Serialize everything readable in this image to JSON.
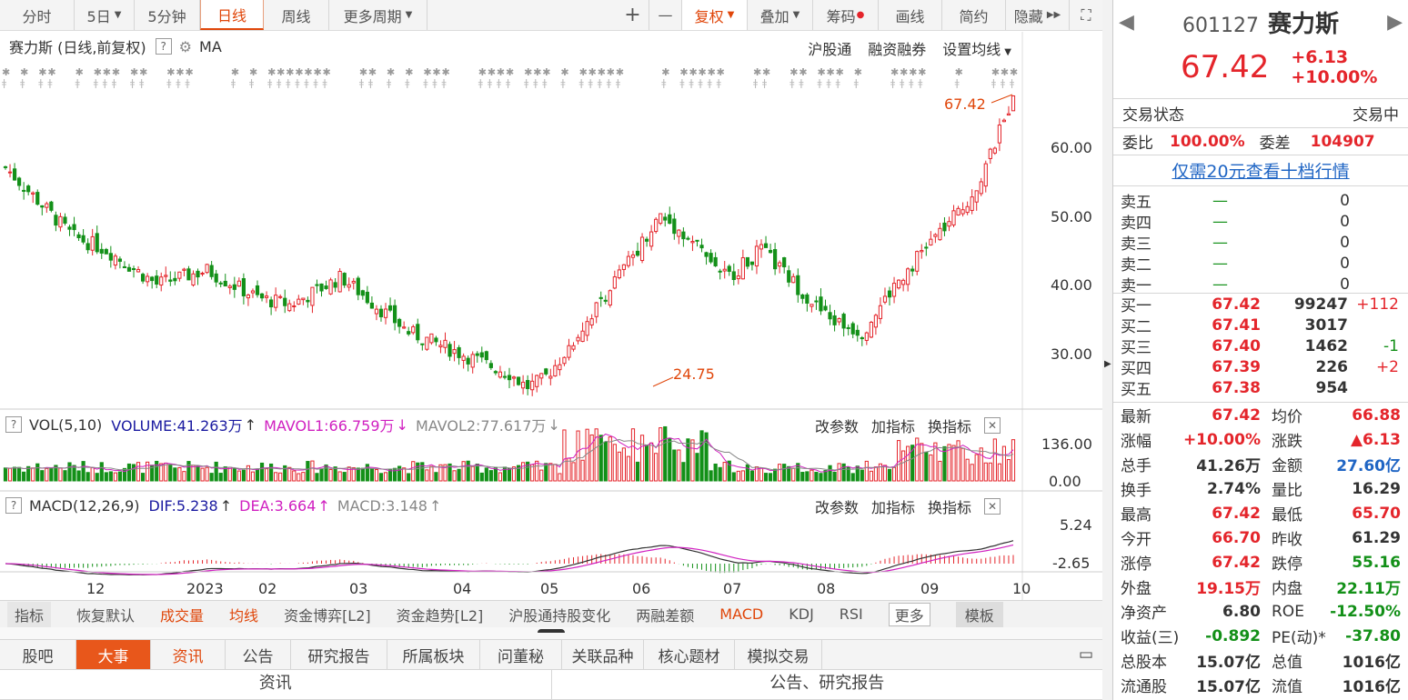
{
  "toolbar": {
    "items": [
      "分时",
      "5日",
      "5分钟",
      "日线",
      "周线",
      "更多周期",
      "复权",
      "叠加",
      "筹码",
      "画线",
      "简约",
      "隐藏"
    ],
    "plus": "+",
    "minus": "—"
  },
  "chart": {
    "title": "赛力斯 (日线,前复权)",
    "ma": "MA",
    "links": [
      "沪股通",
      "融资融券",
      "设置均线"
    ],
    "price_axis": [
      "60.00",
      "50.00",
      "40.00",
      "30.00"
    ],
    "max_label": "67.42",
    "min_label": "24.75"
  },
  "vol": {
    "label": "VOL(5,10)",
    "volume": "VOLUME:41.263万",
    "mavol1": "MAVOL1:66.759万",
    "mavol2": "MAVOL2:77.617万",
    "axis": [
      "136.00",
      "0.00"
    ],
    "actions": [
      "改参数",
      "加指标",
      "换指标"
    ]
  },
  "macd": {
    "label": "MACD(12,26,9)",
    "dif": "DIF:5.238",
    "dea": "DEA:3.664",
    "macd": "MACD:3.148",
    "axis": [
      "5.24",
      "-2.65"
    ],
    "actions": [
      "改参数",
      "加指标",
      "换指标"
    ]
  },
  "dates": [
    "12",
    "2023",
    "02",
    "03",
    "04",
    "05",
    "06",
    "07",
    "08",
    "09",
    "10"
  ],
  "indicators": [
    "指标",
    "恢复默认",
    "成交量",
    "均线",
    "资金博弈[L2]",
    "资金趋势[L2]",
    "沪股通持股变化",
    "两融差额",
    "MACD",
    "KDJ",
    "RSI",
    "更多",
    "模板"
  ],
  "tabs": [
    "股吧",
    "大事",
    "资讯",
    "公告",
    "研究报告",
    "所属板块",
    "问董秘",
    "关联品种",
    "核心题材",
    "模拟交易"
  ],
  "subtabs": [
    "资讯",
    "公告、研究报告"
  ],
  "quote": {
    "code": "601127",
    "name": "赛力斯",
    "price": "67.42",
    "change": "+6.13",
    "pct": "+10.00%",
    "status_label": "交易状态",
    "status": "交易中",
    "wb_label": "委比",
    "wb": "100.00%",
    "wc_label": "委差",
    "wc": "104907",
    "promo": "仅需20元查看十档行情"
  },
  "asks": [
    {
      "l": "卖五",
      "p": "—",
      "v": "0"
    },
    {
      "l": "卖四",
      "p": "—",
      "v": "0"
    },
    {
      "l": "卖三",
      "p": "—",
      "v": "0"
    },
    {
      "l": "卖二",
      "p": "—",
      "v": "0"
    },
    {
      "l": "卖一",
      "p": "—",
      "v": "0"
    }
  ],
  "bids": [
    {
      "l": "买一",
      "p": "67.42",
      "v": "99247",
      "d": "+112"
    },
    {
      "l": "买二",
      "p": "67.41",
      "v": "3017",
      "d": ""
    },
    {
      "l": "买三",
      "p": "67.40",
      "v": "1462",
      "d": "-1"
    },
    {
      "l": "买四",
      "p": "67.39",
      "v": "226",
      "d": "+2"
    },
    {
      "l": "买五",
      "p": "67.38",
      "v": "954",
      "d": ""
    }
  ],
  "stats": [
    [
      "最新",
      "67.42",
      "均价",
      "66.88"
    ],
    [
      "涨幅",
      "+10.00%",
      "涨跌",
      "▲6.13"
    ],
    [
      "总手",
      "41.26万",
      "金额",
      "27.60亿"
    ],
    [
      "换手",
      "2.74%",
      "量比",
      "16.29"
    ],
    [
      "最高",
      "67.42",
      "最低",
      "65.70"
    ],
    [
      "今开",
      "66.70",
      "昨收",
      "61.29"
    ],
    [
      "涨停",
      "67.42",
      "跌停",
      "55.16"
    ],
    [
      "外盘",
      "19.15万",
      "内盘",
      "22.11万"
    ],
    [
      "净资产",
      "6.80",
      "ROE",
      "-12.50%"
    ],
    [
      "收益(三)",
      "-0.892",
      "PE(动)*",
      "-37.80"
    ],
    [
      "总股本",
      "15.07亿",
      "总值",
      "1016亿"
    ],
    [
      "流通股",
      "15.07亿",
      "流值",
      "1016亿"
    ]
  ],
  "chart_data": {
    "type": "candlestick",
    "series": [
      {
        "name": "price",
        "points": [
          [
            0,
            57
          ],
          [
            4,
            52
          ],
          [
            8,
            47
          ],
          [
            12,
            45
          ],
          [
            18,
            40
          ],
          [
            24,
            42
          ],
          [
            30,
            38
          ],
          [
            34,
            37
          ],
          [
            40,
            41
          ],
          [
            44,
            37
          ],
          [
            48,
            33
          ],
          [
            52,
            31
          ],
          [
            56,
            29
          ],
          [
            60,
            27
          ],
          [
            62,
            25
          ],
          [
            64,
            26
          ],
          [
            66,
            29
          ],
          [
            70,
            36
          ],
          [
            74,
            43
          ],
          [
            78,
            50
          ],
          [
            82,
            46
          ],
          [
            86,
            41
          ],
          [
            90,
            45
          ],
          [
            94,
            40
          ],
          [
            98,
            35
          ],
          [
            102,
            33
          ],
          [
            106,
            40
          ],
          [
            110,
            46
          ],
          [
            114,
            51
          ],
          [
            116,
            55
          ],
          [
            118,
            61
          ],
          [
            120,
            67.42
          ]
        ]
      }
    ]
  }
}
